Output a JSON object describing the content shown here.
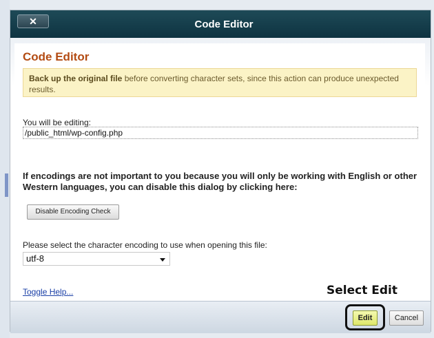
{
  "dialog": {
    "title": "Code Editor",
    "close_label": "✕"
  },
  "content": {
    "heading": "Code Editor",
    "warning_bold": "Back up the original file",
    "warning_rest": " before converting character sets, since this action can produce unexpected results.",
    "editing_label": "You will be editing:",
    "file_path": "/public_html/wp-config.php",
    "encoding_message": "If encodings are not important to you because you will only be working with English or other Western languages, you can disable this dialog by clicking here:",
    "disable_button": "Disable Encoding Check",
    "select_label": "Please select the character encoding to use when opening this file:",
    "encoding_value": "utf-8",
    "toggle_help": "Toggle Help..."
  },
  "footer": {
    "edit_button": "Edit",
    "cancel_button": "Cancel"
  },
  "annotation": {
    "callout": "Select Edit"
  },
  "colors": {
    "titlebar": "#0e3341",
    "heading": "#b34b13",
    "warning_bg": "#fbf3c6",
    "edit_button": "#dfe86b",
    "link": "#1a3fa6"
  }
}
